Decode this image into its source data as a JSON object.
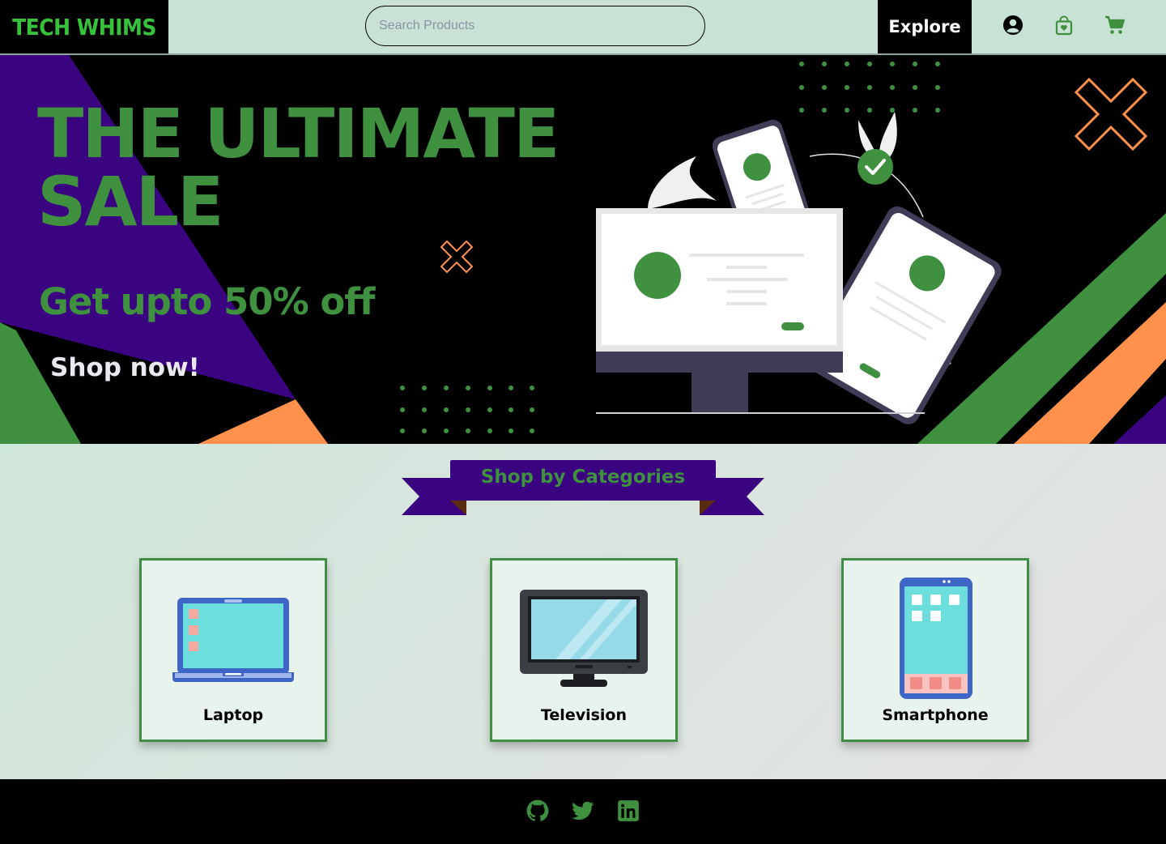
{
  "header": {
    "logo": "TECH WHIMS",
    "search_placeholder": "Search Products",
    "explore_label": "Explore",
    "icons": [
      "user-icon",
      "shopping-bag-icon",
      "cart-icon"
    ]
  },
  "banner": {
    "title_line1": "THE ULTIMATE",
    "title_line2": "SALE",
    "subtitle": "Get upto 50% off",
    "cta": "Shop now!"
  },
  "categories": {
    "heading": "Shop by Categories",
    "items": [
      {
        "label": "Laptop",
        "icon": "laptop-icon"
      },
      {
        "label": "Television",
        "icon": "television-icon"
      },
      {
        "label": "Smartphone",
        "icon": "smartphone-icon"
      }
    ]
  },
  "footer": {
    "icons": [
      "github-icon",
      "twitter-icon",
      "linkedin-icon"
    ]
  },
  "colors": {
    "brand_green": "#3f9140",
    "logo_green": "#37c23b",
    "purple": "#3a0480",
    "orange": "#ff914d",
    "header_bg": "#c8e3d6"
  }
}
